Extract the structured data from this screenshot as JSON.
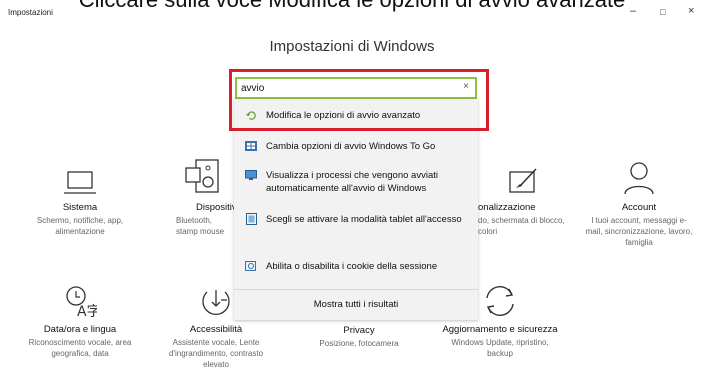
{
  "caption": "Cliccare sulla voce Modifica le opzioni di avvio avanzate",
  "window": {
    "title": "Impostazioni",
    "minimize": "–",
    "maximize": "□",
    "close": "×"
  },
  "page_title": "Impostazioni di Windows",
  "search": {
    "value": "avvio",
    "clear": "×"
  },
  "suggestions": [
    {
      "label": "Modifica le opzioni di avvio avanzato",
      "icon": "recovery-icon"
    },
    {
      "label": "Cambia opzioni di avvio Windows To Go",
      "icon": "windows-to-go-icon"
    },
    {
      "label": "Visualizza i processi che vengono avviati automaticamente all'avvio di Windows",
      "icon": "monitor-icon"
    },
    {
      "label": "Scegli se attivare la modalità tablet all'accesso",
      "icon": "tablet-icon"
    },
    {
      "label": "Abilita o disabilita i cookie della sessione",
      "icon": "cookie-icon"
    }
  ],
  "show_all": "Mostra tutti i risultati",
  "categories": {
    "sistema": {
      "title": "Sistema",
      "desc": "Schermo, notifiche, app, alimentazione",
      "icon": "laptop-icon"
    },
    "dispositivi": {
      "title": "Dispositiv",
      "desc": "Bluetooth, stamp mouse",
      "icon": "keyboard-icon"
    },
    "personalizzazione": {
      "title": "onalizzazione",
      "desc": "do, schermata di blocco, colori",
      "icon": "brush-icon"
    },
    "account": {
      "title": "Account",
      "desc": "I tuoi account, messaggi e-mail, sincronizzazione, lavoro, famiglia",
      "icon": "person-icon"
    },
    "data": {
      "title": "Data/ora e lingua",
      "desc": "Riconoscimento vocale, area geografica, data",
      "icon": "language-icon"
    },
    "accessibilita": {
      "title": "Accessibilità",
      "desc": "Assistente vocale, Lente d'ingrandimento, contrasto elevato",
      "icon": "accessibility-icon"
    },
    "privacy": {
      "title": "Privacy",
      "desc": "Posizione, fotocamera",
      "icon": "lock-icon"
    },
    "aggiornamento": {
      "title": "Aggiornamento e sicurezza",
      "desc": "Windows Update, ripristino, backup",
      "icon": "update-icon"
    }
  },
  "colors": {
    "accent": "#8bc23f",
    "highlight": "#d61f2b"
  }
}
